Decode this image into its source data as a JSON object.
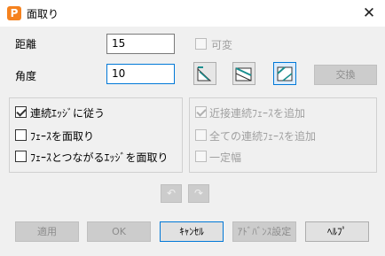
{
  "window": {
    "title": "面取り",
    "app_icon_letter": "P",
    "close_glyph": "✕"
  },
  "distance": {
    "label": "距離",
    "value": "15"
  },
  "angle": {
    "label": "角度",
    "value": "10"
  },
  "variable": {
    "label": "可変",
    "checked": false,
    "enabled": false
  },
  "chamfer_type_icons": [
    "chamfer-type-1-icon",
    "chamfer-type-2-icon",
    "chamfer-type-3-icon"
  ],
  "swap_label": "交換",
  "left_options": [
    {
      "label": "連続ｴｯｼﾞに従う",
      "checked": true
    },
    {
      "label": "ﾌｪｰｽを面取り",
      "checked": false
    },
    {
      "label": "ﾌｪｰｽとつながるｴｯｼﾞを面取り",
      "checked": false
    }
  ],
  "right_options": [
    {
      "label": "近接連続ﾌｪｰｽを追加",
      "checked": true,
      "enabled": false
    },
    {
      "label": "全ての連続ﾌｪｰｽを追加",
      "checked": false,
      "enabled": false
    },
    {
      "label": "一定幅",
      "checked": false,
      "enabled": false
    }
  ],
  "nav": {
    "undo_icon": "↶",
    "redo_icon": "↷"
  },
  "buttons": {
    "apply": "適用",
    "ok": "OK",
    "cancel": "ｷｬﾝｾﾙ",
    "advanced": "ｱﾄﾞﾊﾞﾝｽ設定",
    "help": "ﾍﾙﾌﾟ"
  },
  "colors": {
    "accent": "#0078d7",
    "app_icon": "#f5821f",
    "icon_teal": "#1a8f8f"
  }
}
